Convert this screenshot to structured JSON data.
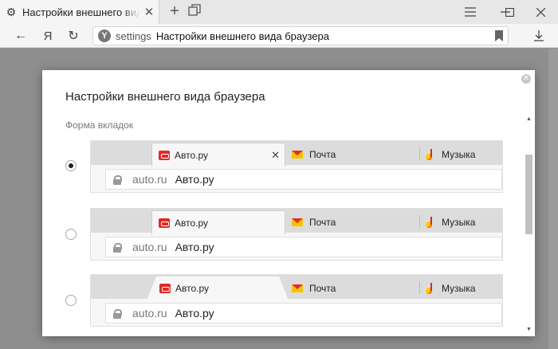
{
  "browser": {
    "tab_title": "Настройки внешнего вида б",
    "omnibox_host": "settings",
    "omnibox_title": "Настройки внешнего вида браузера",
    "yandex_letter": "Я",
    "yandex_badge": "Y"
  },
  "icons": {
    "gear": "⚙",
    "close": "✕",
    "plus": "+",
    "minimize": "—",
    "maximize": "☐",
    "back": "←",
    "reload": "↻",
    "download": "⤓"
  },
  "dialog": {
    "title": "Настройки внешнего вида браузера",
    "section_label": "Форма вкладок",
    "close_glyph": "✕",
    "selected_option": 0,
    "options": [
      {
        "active_tab": "Авто.ру",
        "tab2": "Почта",
        "tab3": "Музыка",
        "host": "auto.ru",
        "page_title": "Авто.ру"
      },
      {
        "active_tab": "Авто.ру",
        "tab2": "Почта",
        "tab3": "Музыка",
        "host": "auto.ru",
        "page_title": "Авто.ру"
      },
      {
        "active_tab": "Авто.ру",
        "tab2": "Почта",
        "tab3": "Музыка",
        "host": "auto.ru",
        "page_title": "Авто.ру"
      }
    ]
  },
  "colors": {
    "accent_red": "#e22b25",
    "mail_yellow": "#f5c400"
  }
}
